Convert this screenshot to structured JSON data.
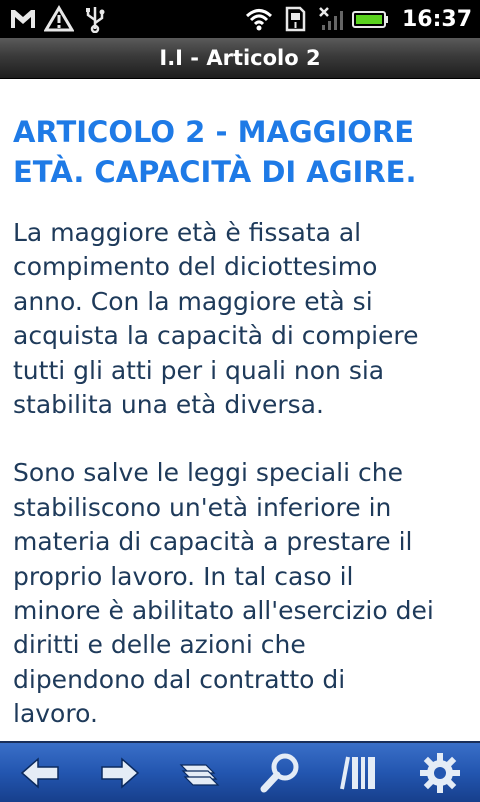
{
  "status_bar": {
    "time": "16:37",
    "left_icons": [
      "gmail-icon",
      "warning-icon",
      "usb-icon"
    ],
    "right_icons": [
      "wifi-icon",
      "sd-card-icon",
      "no-signal-icon",
      "battery-icon"
    ]
  },
  "title_bar": {
    "title": "I.I - Articolo 2"
  },
  "article": {
    "heading_line1": "ARTICOLO 2 - MAGGIORE",
    "heading_line2": "ETÀ. CAPACITÀ DI AGIRE.",
    "paragraph1_lines": [
      "La maggiore età è fissata al",
      "compimento del diciottesimo",
      "anno. Con la maggiore età si",
      "acquista la capacità di compiere",
      "tutti gli atti per i quali non sia",
      "stabilita una età diversa."
    ],
    "paragraph2_lines": [
      "Sono salve le leggi speciali che",
      "stabiliscono un'età inferiore in",
      "materia di capacità a prestare il",
      "proprio lavoro. In tal caso il",
      "minore è abilitato all'esercizio dei",
      "diritti e delle azioni che",
      "dipendono dal contratto di",
      "lavoro."
    ],
    "heading_color": "#1e7ae6",
    "text_color": "#1e3a5a"
  },
  "toolbar": {
    "buttons": [
      "back-arrow-icon",
      "forward-arrow-icon",
      "bookmarks-icon",
      "search-icon",
      "library-icon",
      "settings-gear-icon"
    ],
    "background_color": "#2356b0"
  }
}
